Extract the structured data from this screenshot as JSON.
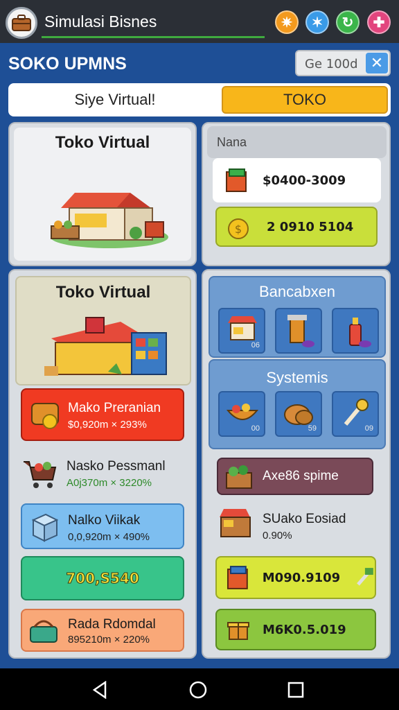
{
  "topbar": {
    "title": "Simulasi Bisnes",
    "icons": [
      "briefcase-icon",
      "orange-burst-icon",
      "blue-burst-icon",
      "green-refresh-icon",
      "pink-plus-icon"
    ]
  },
  "header": {
    "title": "SOKO UPMNS",
    "search_value": "Ge 100d",
    "close_icon": "close-icon"
  },
  "tabs": [
    {
      "label": "Siye Virtual!"
    },
    {
      "label": "TOKO"
    }
  ],
  "left_top": {
    "title": "Toko Virtual",
    "image": "market-stall-icon"
  },
  "right_top": {
    "label": "Nana",
    "money_rows": [
      {
        "value": "$0400-3009",
        "icon": "crate-icon"
      },
      {
        "value": "2 0910 5104",
        "icon": "coin-bag-icon"
      }
    ]
  },
  "left_main": {
    "title": "Toko Virtual",
    "items": [
      {
        "name": "Mako Preranian",
        "sub": "$0,920m × 293%",
        "color": "#f03a22"
      },
      {
        "name": "Nasko Pessmanl",
        "sub": "A0j370m × 3220%",
        "color": "#e9ebee"
      },
      {
        "name": "Nalko Viikak",
        "sub": "0,0,920m × 490%",
        "color": "#7dbef0"
      },
      {
        "name": "700,S540",
        "sub": "",
        "color": "#38c48a"
      },
      {
        "name": "Rada Rdomdal",
        "sub": "895210m × 220%",
        "color": "#f9a878"
      }
    ]
  },
  "right_main": {
    "section1_title": "Bancabxen",
    "section1_tiles": [
      {
        "icon": "shop-stall-icon",
        "num": "06"
      },
      {
        "icon": "drink-machine-icon",
        "num": ""
      },
      {
        "icon": "spray-bottle-icon",
        "num": ""
      }
    ],
    "section2_title": "Systemis",
    "section2_tiles": [
      {
        "icon": "food-bowl-icon",
        "num": "00"
      },
      {
        "icon": "bread-icon",
        "num": "59"
      },
      {
        "icon": "microphone-icon",
        "num": "09"
      }
    ],
    "rows": [
      {
        "name": "Axe86 spime",
        "sub": "",
        "color": "#7a4a58"
      },
      {
        "name": "SUako Eosiad",
        "sub": "0.90%",
        "color": ""
      },
      {
        "name": "M090.9109",
        "sub": "",
        "color": "#d9e63a"
      },
      {
        "name": "M6K0.5.019",
        "sub": "",
        "color": "#8cc63f"
      }
    ]
  },
  "navbar": {
    "icons": [
      "back-icon",
      "home-icon",
      "recents-icon"
    ]
  }
}
